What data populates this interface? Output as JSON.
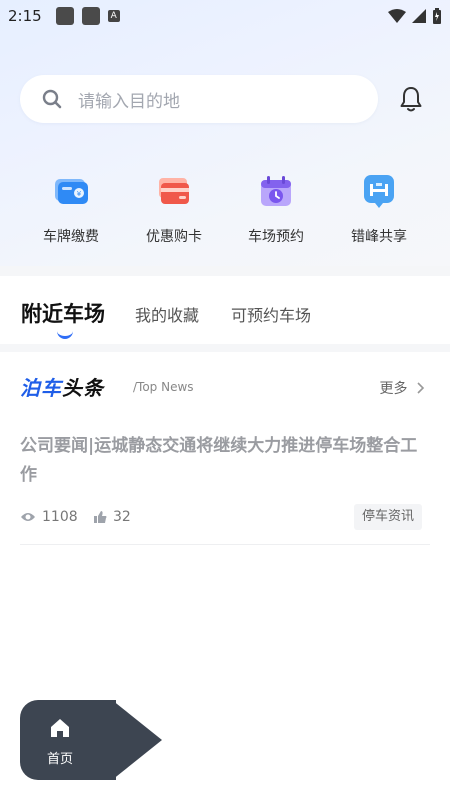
{
  "status_bar": {
    "time": "2:15",
    "indicator": "A"
  },
  "search": {
    "placeholder": "请输入目的地"
  },
  "quick_actions": [
    {
      "label": "车牌缴费",
      "icon": "payment-card-icon",
      "color": "#3b8df4"
    },
    {
      "label": "优惠购卡",
      "icon": "cards-icon",
      "color": "#f26b5c"
    },
    {
      "label": "车场预约",
      "icon": "calendar-clock-icon",
      "color": "#8a6cf2"
    },
    {
      "label": "错峰共享",
      "icon": "share-parking-icon",
      "color": "#4aa3f3"
    }
  ],
  "tabs": [
    {
      "label": "附近车场",
      "active": true
    },
    {
      "label": "我的收藏",
      "active": false
    },
    {
      "label": "可预约车场",
      "active": false
    }
  ],
  "news": {
    "brand_part1": "泊车",
    "brand_part2": "头条",
    "brand_sub": "/Top News",
    "more_label": "更多",
    "article": {
      "title": "公司要闻|运城静态交通将继续大力推进停车场整合工作",
      "views": "1108",
      "likes": "32",
      "tag": "停车资讯"
    }
  },
  "bottom_nav": {
    "home_label": "首页"
  },
  "colors": {
    "accent": "#2f6df6",
    "nav_bg": "#3d4551"
  }
}
